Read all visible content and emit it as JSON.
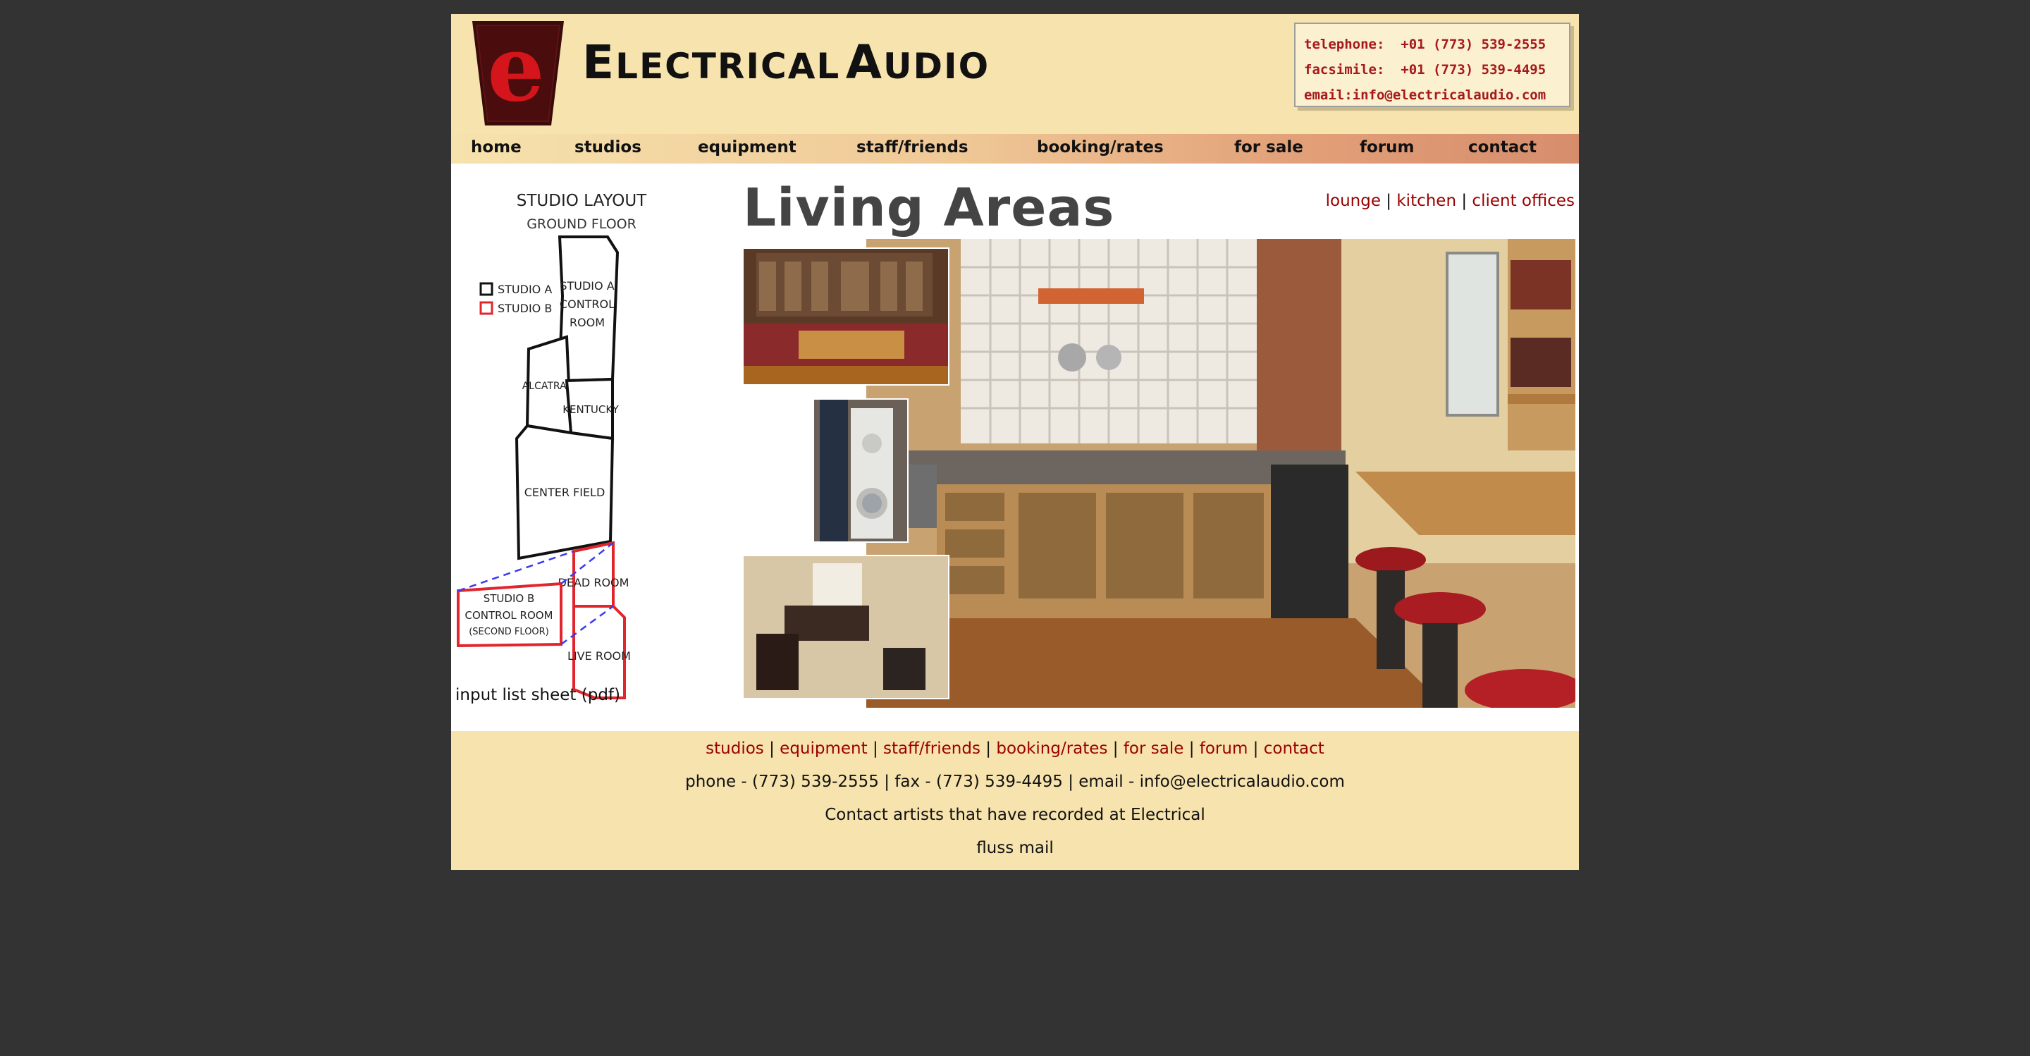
{
  "site": {
    "logo_letter": "e",
    "brand_first_big": "E",
    "brand_first_small": "LECTRICAL",
    "brand_second_big": "A",
    "brand_second_small": "UDIO"
  },
  "contact_box": {
    "telephone": "telephone:  +01 (773) 539-2555",
    "facsimile": "facsimile:  +01 (773) 539-4495",
    "email": "email:info@electricalaudio.com"
  },
  "nav": [
    {
      "label": "home"
    },
    {
      "label": "studios"
    },
    {
      "label": "equipment"
    },
    {
      "label": "staff/friends"
    },
    {
      "label": "booking/rates"
    },
    {
      "label": "for sale"
    },
    {
      "label": "forum"
    },
    {
      "label": "contact"
    }
  ],
  "layout_map": {
    "title": "STUDIO LAYOUT",
    "subtitle": "GROUND FLOOR",
    "legend_a": "STUDIO A",
    "legend_b": "STUDIO B",
    "room_control_a_1": "STUDIO A",
    "room_control_a_2": "CONTROL",
    "room_control_a_3": "ROOM",
    "room_alcatraz": "ALCATRAZ",
    "room_kentucky": "KENTUCKY",
    "room_center": "CENTER FIELD",
    "room_dead": "DEAD ROOM",
    "room_live": "LIVE ROOM",
    "room_control_b_1": "STUDIO B",
    "room_control_b_2": "CONTROL ROOM",
    "room_control_b_3": "(SECOND FLOOR)",
    "color_a": "#111111",
    "color_b": "#e0262c",
    "color_link": "#3a3af0"
  },
  "input_list": "input list sheet (pdf)",
  "main": {
    "title": "Living Areas",
    "sub_links": [
      "lounge",
      "kitchen",
      "client offices"
    ],
    "sub_sep": "|"
  },
  "footer": {
    "links": [
      "studios",
      "equipment",
      "staff/friends",
      "booking/rates",
      "for sale",
      "forum",
      "contact"
    ],
    "sep": "|",
    "phone_line": "phone - (773) 539-2555 | fax - (773) 539-4495 | email - info@electricalaudio.com",
    "artists_line": "Contact artists that have recorded at Electrical",
    "fluss_line": "fluss mail"
  },
  "colors": {
    "background": "#333333",
    "header_bg": "#f6e3ad",
    "link_red": "#9a0000",
    "logo_red": "#c4161c",
    "logo_dark": "#3b0a0a"
  }
}
